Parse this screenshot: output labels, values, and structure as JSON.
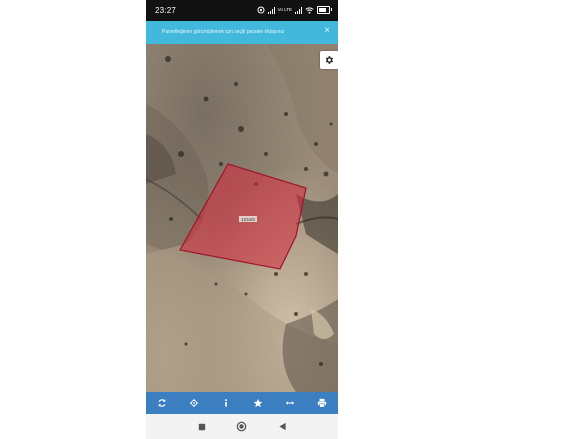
{
  "status_bar": {
    "time": "23:27",
    "network_label": "Vo LTE",
    "battery_label": "80"
  },
  "notice": {
    "text": "Parselleğinen görüntülemek için seçili parsele tıklayınız",
    "close_symbol": "×"
  },
  "map": {
    "parcel_label": "1234/5"
  },
  "colors": {
    "toolbar": "#3b7fc0",
    "notice": "#42b8dd",
    "parcel_stroke": "#a0142a",
    "parcel_fill": "rgba(215,40,60,0.55)"
  },
  "toolbar": {
    "buttons": [
      {
        "icon": "refresh-icon"
      },
      {
        "icon": "locate-icon"
      },
      {
        "icon": "info-icon"
      },
      {
        "icon": "star-icon"
      },
      {
        "icon": "measure-icon"
      },
      {
        "icon": "print-icon"
      }
    ]
  },
  "nav_bar": {
    "icons": [
      "recent-apps-icon",
      "home-icon",
      "back-icon"
    ]
  }
}
